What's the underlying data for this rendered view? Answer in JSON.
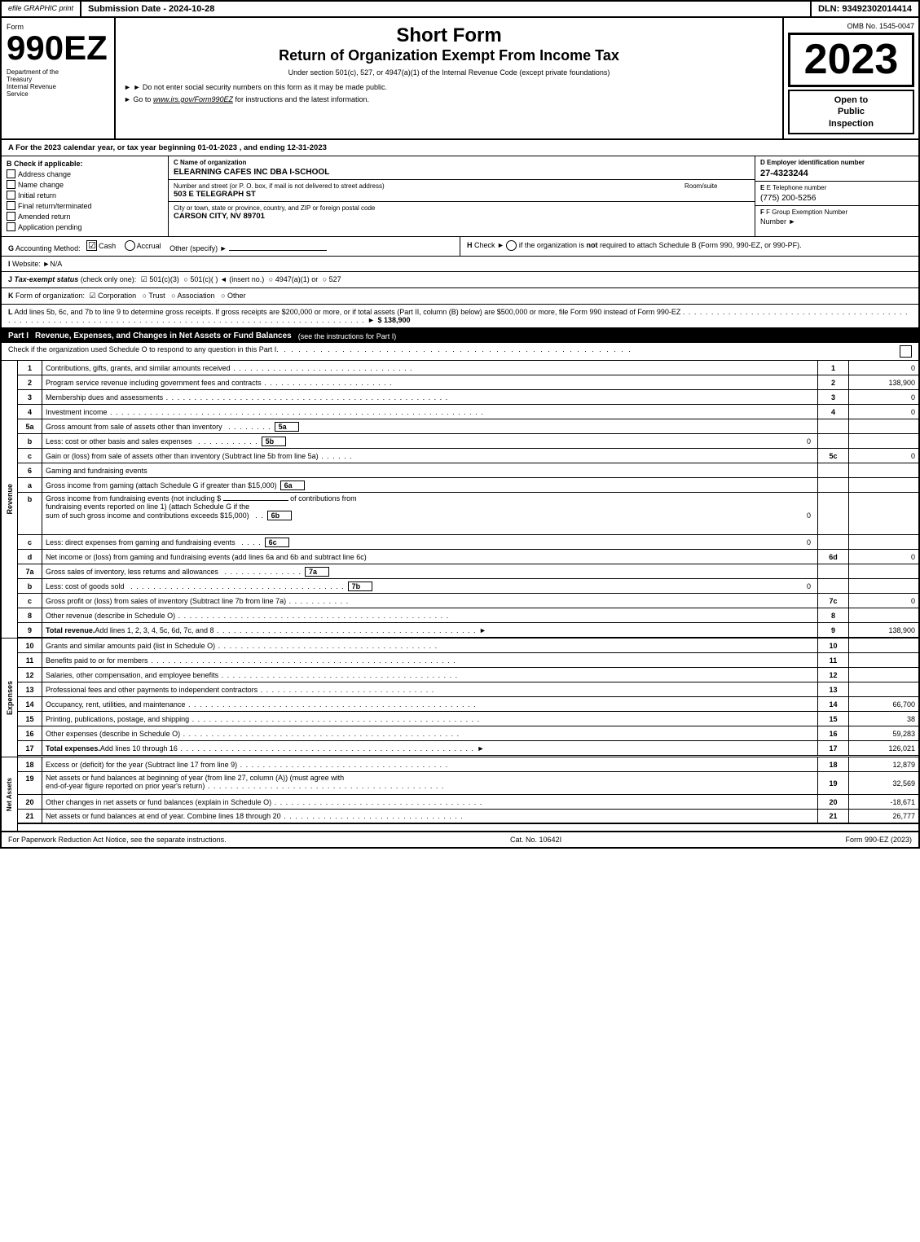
{
  "topBar": {
    "graphic": "efile GRAPHIC print",
    "submission": "Submission Date - 2024-10-28",
    "dln": "DLN: 93492302014414"
  },
  "header": {
    "formPrefix": "Form",
    "formNumber": "990EZ",
    "deptLine1": "Department of the",
    "deptLine2": "Treasury",
    "deptLine3": "Internal Revenue",
    "deptLine4": "Service",
    "title1": "Short Form",
    "title2": "Return of Organization Exempt From Income Tax",
    "subtitle": "Under section 501(c), 527, or 4947(a)(1) of the Internal Revenue Code (except private foundations)",
    "instruction1": "► Do not enter social security numbers on this form as it may be made public.",
    "instruction2": "► Go to www.irs.gov/Form990EZ for instructions and the latest information.",
    "ombNumber": "OMB No. 1545-0047",
    "year": "2023",
    "openToPublic": "Open to Public Inspection"
  },
  "sectionA": {
    "label": "A",
    "text": "For the 2023 calendar year, or tax year beginning 01-01-2023 , and ending 12-31-2023"
  },
  "sectionB": {
    "label": "B",
    "checkLabel": "Check if applicable:",
    "items": [
      {
        "label": "Address change",
        "checked": false
      },
      {
        "label": "Name change",
        "checked": false
      },
      {
        "label": "Initial return",
        "checked": false
      },
      {
        "label": "Final return/terminated",
        "checked": false
      },
      {
        "label": "Amended return",
        "checked": false
      },
      {
        "label": "Application pending",
        "checked": false
      }
    ]
  },
  "sectionC": {
    "label": "C",
    "nameLabel": "Name of organization",
    "orgName": "ELEARNING CAFES INC DBA I-SCHOOL",
    "addressLabel": "Number and street (or P. O. box, if mail is not delivered to street address)",
    "address": "503 E TELEGRAPH ST",
    "roomLabel": "Room/suite",
    "cityLabel": "City or town, state or province, country, and ZIP or foreign postal code",
    "city": "CARSON CITY, NV  89701"
  },
  "sectionD": {
    "label": "D",
    "einLabel": "Employer identification number",
    "ein": "27-4323244",
    "phoneLabel": "E Telephone number",
    "phone": "(775) 200-5256",
    "groupLabel": "F Group Exemption Number",
    "groupArrow": "►"
  },
  "sectionG": {
    "label": "G",
    "text": "Accounting Method:",
    "cashChecked": true,
    "cashLabel": "Cash",
    "accrualChecked": false,
    "accrualLabel": "Accrual",
    "otherLabel": "Other (specify) ►",
    "underline": "________________________"
  },
  "sectionH": {
    "label": "H",
    "text": "Check ► ○ if the organization is not required to attach Schedule B (Form 990, 990-EZ, or 990-PF)."
  },
  "sectionI": {
    "label": "I",
    "text": "Website: ►N/A"
  },
  "sectionJ": {
    "label": "J",
    "text": "Tax-exempt status (check only one): ☑ 501(c)(3) ○ 501(c)( ) ◄ (insert no.) ○ 4947(a)(1) or ○ 527"
  },
  "sectionK": {
    "label": "K",
    "text": "Form of organization: ☑ Corporation  ○ Trust  ○ Association  ○ Other"
  },
  "sectionL": {
    "label": "L",
    "text": "Add lines 5b, 6c, and 7b to line 9 to determine gross receipts. If gross receipts are $200,000 or more, or if total assets (Part II, column (B) below) are $500,000 or more, file Form 990 instead of Form 990-EZ",
    "dots": ". . . . . . . . . . . . . . . . . . . . . . . . . . . . . . . . . . . . . . . . . . . . . . . . . . ►",
    "value": "$ 138,900"
  },
  "partI": {
    "label": "Part I",
    "title": "Revenue, Expenses, and Changes in Net Assets or Fund Balances",
    "subtitle": "(see the instructions for Part I)",
    "checkLine": "Check if the organization used Schedule O to respond to any question in this Part I",
    "rows": [
      {
        "num": "1",
        "desc": "Contributions, gifts, grants, and similar amounts received",
        "dots": ". . . . . . . . . . . . . . . . . . . . . . . . . . . . . . . .",
        "lineNum": "1",
        "value": "0"
      },
      {
        "num": "2",
        "desc": "Program service revenue including government fees and contracts",
        "dots": ". . . . . . . . . . . . . . . . . . . . . . .",
        "lineNum": "2",
        "value": "138,900"
      },
      {
        "num": "3",
        "desc": "Membership dues and assessments",
        "dots": ". . . . . . . . . . . . . . . . . . . . . . . . . . . . . . . . . . . . . . . . . . . . . . . . . .",
        "lineNum": "3",
        "value": "0"
      },
      {
        "num": "4",
        "desc": "Investment income",
        "dots": ". . . . . . . . . . . . . . . . . . . . . . . . . . . . . . . . . . . . . . . . . . . . . . . . . . . . . . . . . . . . . . . . . .",
        "lineNum": "4",
        "value": "0"
      }
    ],
    "row5a": {
      "num": "5a",
      "desc": "Gross amount from sale of assets other than inventory",
      "dots": ". . . . . . . .",
      "fieldNum": "5a",
      "value": ""
    },
    "row5b": {
      "num": "b",
      "desc": "Less: cost or other basis and sales expenses",
      "dots": ". . . . . . . . . . .",
      "fieldNum": "5b",
      "value": "0"
    },
    "row5c": {
      "num": "c",
      "desc": "Gain or (loss) from sale of assets other than inventory (Subtract line 5b from line 5a)",
      "dots": ". . . . . .",
      "lineNum": "5c",
      "value": "0"
    },
    "row6": {
      "num": "6",
      "desc": "Gaming and fundraising events"
    },
    "row6a": {
      "num": "a",
      "desc": "Gross income from gaming (attach Schedule G if greater than $15,000)",
      "fieldNum": "6a",
      "value": ""
    },
    "row6b_desc": "Gross income from fundraising events (not including $",
    "row6b_desc2": "of contributions from",
    "row6b_desc3": "fundraising events reported on line 1) (attach Schedule G if the",
    "row6b_desc4": "sum of such gross income and contributions exceeds $15,000)",
    "row6b": {
      "fieldNum": "6b",
      "value": "0"
    },
    "row6c": {
      "num": "c",
      "desc": "Less: direct expenses from gaming and fundraising events",
      "dots": ". . . .",
      "fieldNum": "6c",
      "value": "0"
    },
    "row6d": {
      "num": "d",
      "desc": "Net income or (loss) from gaming and fundraising events (add lines 6a and 6b and subtract line 6c)",
      "lineNum": "6d",
      "value": "0"
    },
    "row7a": {
      "num": "7a",
      "desc": "Gross sales of inventory, less returns and allowances",
      "dots": ". . . . . . . . . . . . . .",
      "fieldNum": "7a",
      "value": ""
    },
    "row7b": {
      "num": "b",
      "desc": "Less: cost of goods sold",
      "dots": ". . . . . . . . . . . . . . . . . . . . . . . . . . . . . . . . . . . . . .",
      "fieldNum": "7b",
      "value": "0"
    },
    "row7c": {
      "num": "c",
      "desc": "Gross profit or (loss) from sales of inventory (Subtract line 7b from line 7a)",
      "dots": ". . . . . . . . . . .",
      "lineNum": "7c",
      "value": "0"
    },
    "row8": {
      "num": "8",
      "desc": "Other revenue (describe in Schedule O)",
      "dots": ". . . . . . . . . . . . . . . . . . . . . . . . . . . . . . . . . . . . . . . . . . . . . . . .",
      "lineNum": "8",
      "value": ""
    },
    "row9": {
      "num": "9",
      "desc": "Total revenue. Add lines 1, 2, 3, 4, 5c, 6d, 7c, and 8",
      "dots": ". . . . . . . . . . . . . . . . . . . . . . . . . . . . . . . . . . . . . . . . . . . . . . ►",
      "lineNum": "9",
      "value": "138,900"
    },
    "expenseRows": [
      {
        "num": "10",
        "desc": "Grants and similar amounts paid (list in Schedule O)",
        "dots": ". . . . . . . . . . . . . . . . . . . . . . . . . . . . . . . . . . . . . . .",
        "lineNum": "10",
        "value": ""
      },
      {
        "num": "11",
        "desc": "Benefits paid to or for members",
        "dots": ". . . . . . . . . . . . . . . . . . . . . . . . . . . . . . . . . . . . . . . . . . . . . . . . . . . . . .",
        "lineNum": "11",
        "value": ""
      },
      {
        "num": "12",
        "desc": "Salaries, other compensation, and employee benefits",
        "dots": ". . . . . . . . . . . . . . . . . . . . . . . . . . . . . . . . . . . . . . . . .",
        "lineNum": "12",
        "value": ""
      },
      {
        "num": "13",
        "desc": "Professional fees and other payments to independent contractors",
        "dots": ". . . . . . . . . . . . . . . . . . . . . . . . . . . . . . .",
        "lineNum": "13",
        "value": ""
      },
      {
        "num": "14",
        "desc": "Occupancy, rent, utilities, and maintenance",
        "dots": ". . . . . . . . . . . . . . . . . . . . . . . . . . . . . . . . . . . . . . . . . . . . . . . . . . .",
        "lineNum": "14",
        "value": "66,700"
      },
      {
        "num": "15",
        "desc": "Printing, publications, postage, and shipping",
        "dots": ". . . . . . . . . . . . . . . . . . . . . . . . . . . . . . . . . . . . . . . . . . . . . . . . . . .",
        "lineNum": "15",
        "value": "38"
      },
      {
        "num": "16",
        "desc": "Other expenses (describe in Schedule O)",
        "dots": ". . . . . . . . . . . . . . . . . . . . . . . . . . . . . . . . . . . . . . . . . . . . . . . . .",
        "lineNum": "16",
        "value": "59,283"
      },
      {
        "num": "17",
        "desc": "Total expenses. Add lines 10 through 16",
        "dots": ". . . . . . . . . . . . . . . . . . . . . . . . . . . . . . . . . . . . . . . . . . . . . . . . . . . . ►",
        "lineNum": "17",
        "value": "126,021",
        "bold": true
      }
    ],
    "netAssetRows": [
      {
        "num": "18",
        "desc": "Excess or (deficit) for the year (Subtract line 17 from line 9)",
        "dots": ". . . . . . . . . . . . . . . . . . . . . . . . . . . . . . . . . . . . .",
        "lineNum": "18",
        "value": "12,879"
      },
      {
        "num": "19",
        "desc": "Net assets or fund balances at beginning of year (from line 27, column (A)) (must agree with end-of-year figure reported on prior year's return)",
        "dots": ". . . . . . . . . . . . . . . . . . . . . . . . . . . . . . . . . . . . . . . . . .",
        "lineNum": "19",
        "value": "32,569"
      },
      {
        "num": "20",
        "desc": "Other changes in net assets or fund balances (explain in Schedule O)",
        "dots": ". . . . . . . . . . . . . . . . . . . . . . . . . . . . . . . . . . . . . .",
        "lineNum": "20",
        "value": "-18,671"
      },
      {
        "num": "21",
        "desc": "Net assets or fund balances at end of year. Combine lines 18 through 20",
        "dots": ". . . . . . . . . . . . . . . . . . . . . . . . . . . . . . . . .",
        "lineNum": "21",
        "value": "26,777"
      }
    ]
  },
  "footer": {
    "paperworkText": "For Paperwork Reduction Act Notice, see the separate instructions.",
    "catNo": "Cat. No. 10642I",
    "formRef": "Form 990-EZ (2023)"
  }
}
